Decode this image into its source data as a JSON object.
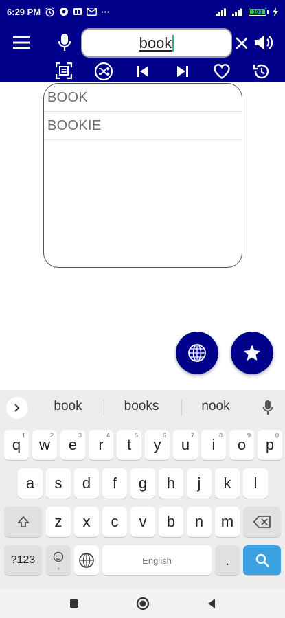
{
  "status": {
    "time": "6:29 PM",
    "battery": "100",
    "overflow": "···",
    "icons": [
      "alarm-icon",
      "app-notification-icon",
      "media-notification-icon",
      "gmail-icon",
      "signal-icon",
      "signal-icon-2",
      "battery-icon",
      "charging-icon"
    ]
  },
  "header": {
    "search_value": "book",
    "icons": [
      "menu-icon",
      "microphone-icon",
      "clear-icon",
      "speaker-icon",
      "scan-icon",
      "shuffle-icon",
      "previous-icon",
      "next-icon",
      "favorite-icon",
      "history-icon"
    ]
  },
  "suggestions": [
    {
      "label": "BOOK"
    },
    {
      "label": "BOOKIE"
    }
  ],
  "fabs": {
    "icons": [
      "globe-icon",
      "star-icon"
    ]
  },
  "keyboard": {
    "suggestions": [
      "book",
      "books",
      "nook"
    ],
    "row1": [
      {
        "label": "q",
        "hint": "1"
      },
      {
        "label": "w",
        "hint": "2"
      },
      {
        "label": "e",
        "hint": "3"
      },
      {
        "label": "r",
        "hint": "4"
      },
      {
        "label": "t",
        "hint": "5"
      },
      {
        "label": "y",
        "hint": "6"
      },
      {
        "label": "u",
        "hint": "7"
      },
      {
        "label": "i",
        "hint": "8"
      },
      {
        "label": "o",
        "hint": "9"
      },
      {
        "label": "p",
        "hint": "0"
      }
    ],
    "row2": [
      "a",
      "s",
      "d",
      "f",
      "g",
      "h",
      "j",
      "k",
      "l"
    ],
    "row3": [
      "z",
      "x",
      "c",
      "v",
      "b",
      "n",
      "m"
    ],
    "symbols_label": "?123",
    "emoji_sub": ",",
    "space_label": "English",
    "period_label": "."
  },
  "colors": {
    "primary": "#00008b",
    "enter_key": "#3ba1e0",
    "battery": "#2ecc40"
  }
}
